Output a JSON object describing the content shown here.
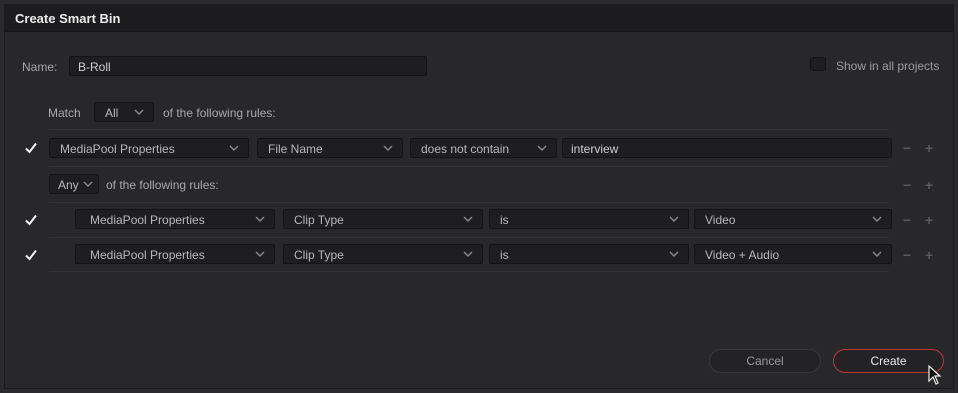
{
  "dialog": {
    "title": "Create Smart Bin"
  },
  "name": {
    "label": "Name:",
    "value": "B-Roll"
  },
  "show_all": {
    "label": "Show in all projects",
    "checked": false
  },
  "match": {
    "label": "Match",
    "value": "All",
    "suffix": "of the following rules:"
  },
  "rule1": {
    "checked": true,
    "category": "MediaPool Properties",
    "field": "File Name",
    "operator": "does not contain",
    "value": "interview"
  },
  "group": {
    "value": "Any",
    "suffix": "of the following rules:"
  },
  "rule2": {
    "checked": true,
    "category": "MediaPool Properties",
    "field": "Clip Type",
    "operator": "is",
    "value": "Video"
  },
  "rule3": {
    "checked": true,
    "category": "MediaPool Properties",
    "field": "Clip Type",
    "operator": "is",
    "value": "Video + Audio"
  },
  "controls": {
    "minus": "−",
    "plus": "+"
  },
  "buttons": {
    "cancel": "Cancel",
    "create": "Create"
  },
  "colors": {
    "accent": "#c0343a",
    "background": "#28282a",
    "field": "#1e1e20"
  },
  "icons": {
    "check": "check-icon",
    "chevron": "chevron-down-icon",
    "pointer": "mouse-pointer-icon"
  }
}
